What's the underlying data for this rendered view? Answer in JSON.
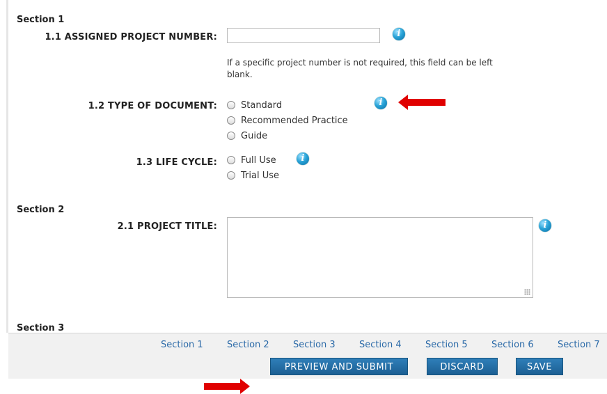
{
  "sections": {
    "s1_heading": "Section 1",
    "s2_heading": "Section 2",
    "s3_heading": "Section 3"
  },
  "fields": {
    "project_number": {
      "label": "1.1 ASSIGNED PROJECT NUMBER:",
      "value": "",
      "help": "If a specific project number is not required, this field can be left blank."
    },
    "doc_type": {
      "label": "1.2 TYPE OF DOCUMENT:",
      "options": [
        "Standard",
        "Recommended Practice",
        "Guide"
      ],
      "selected": null
    },
    "life_cycle": {
      "label": "1.3 LIFE CYCLE:",
      "options": [
        "Full Use",
        "Trial Use"
      ],
      "selected": null
    },
    "project_title": {
      "label": "2.1 PROJECT TITLE:",
      "value": ""
    }
  },
  "icons": {
    "info": "info-icon",
    "arrow": "red-arrow-icon"
  },
  "footer": {
    "section_links": [
      "Section 1",
      "Section 2",
      "Section 3",
      "Section 4",
      "Section 5",
      "Section 6",
      "Section 7"
    ],
    "buttons": {
      "preview_submit": "PREVIEW AND SUBMIT",
      "discard": "DISCARD",
      "save": "SAVE"
    }
  },
  "colors": {
    "button_blue": "#1c5f93",
    "link_blue": "#2b6aa8",
    "arrow_red": "#e00000"
  }
}
